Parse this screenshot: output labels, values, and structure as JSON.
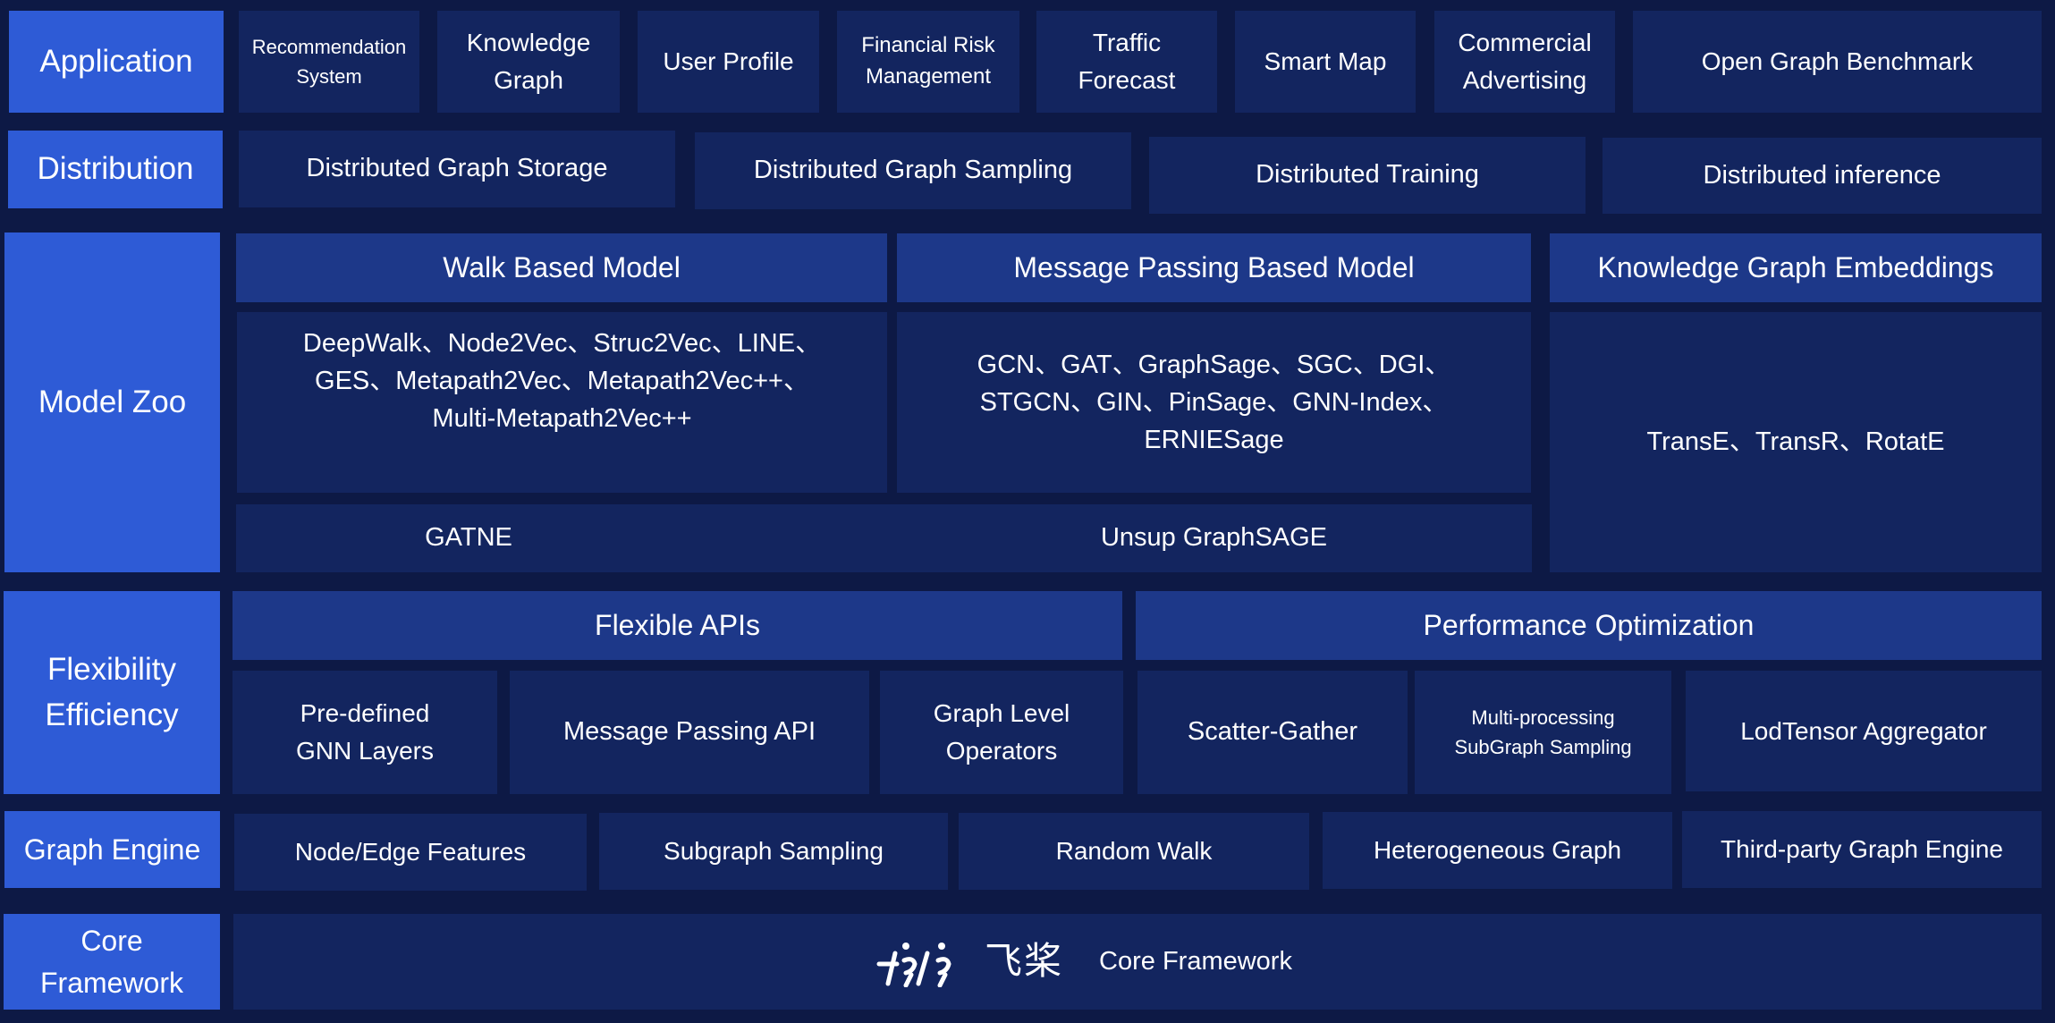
{
  "colors": {
    "background": "#0d1945",
    "layer_label": "#2e5bd6",
    "group_header": "#1d3889",
    "cell": "#13255f",
    "text": "#ffffff"
  },
  "layers": {
    "application": {
      "label": "Application",
      "items": [
        "Recommendation\nSystem",
        "Knowledge\nGraph",
        "User Profile",
        "Financial Risk\nManagement",
        "Traffic\nForecast",
        "Smart Map",
        "Commercial\nAdvertising",
        "Open Graph Benchmark"
      ]
    },
    "distribution": {
      "label": "Distribution",
      "items": [
        "Distributed Graph Storage",
        "Distributed Graph Sampling",
        "Distributed Training",
        "Distributed inference"
      ]
    },
    "model_zoo": {
      "label": "Model Zoo",
      "walk_based": {
        "header": "Walk Based Model",
        "models": "DeepWalk、Node2Vec、Struc2Vec、LINE、\nGES、Metapath2Vec、Metapath2Vec++、\nMulti-Metapath2Vec++"
      },
      "message_passing": {
        "header": "Message Passing Based Model",
        "models": "GCN、GAT、GraphSage、SGC、DGI、\nSTGCN、GIN、PinSage、GNN-Index、\nERNIESage"
      },
      "kg_embeddings": {
        "header": "Knowledge Graph Embeddings",
        "models": "TransE、TransR、RotatE"
      },
      "shared_row": [
        "GATNE",
        "Unsup GraphSAGE"
      ]
    },
    "flexibility": {
      "label": "Flexibility\nEfficiency",
      "flexible_apis": {
        "header": "Flexible APIs",
        "items": [
          "Pre-defined\nGNN Layers",
          "Message Passing API",
          "Graph Level\nOperators"
        ]
      },
      "performance": {
        "header": "Performance Optimization",
        "items": [
          "Scatter-Gather",
          "Multi-processing\nSubGraph Sampling",
          "LodTensor Aggregator"
        ]
      }
    },
    "graph_engine": {
      "label": "Graph Engine",
      "items": [
        "Node/Edge Features",
        "Subgraph Sampling",
        "Random Walk",
        "Heterogeneous Graph",
        "Third-party Graph Engine"
      ]
    },
    "core": {
      "label": "Core\nFramework",
      "logo_text": "飞桨",
      "logo_icon": "paddlepaddle-logo-icon",
      "item": "Core Framework"
    }
  }
}
